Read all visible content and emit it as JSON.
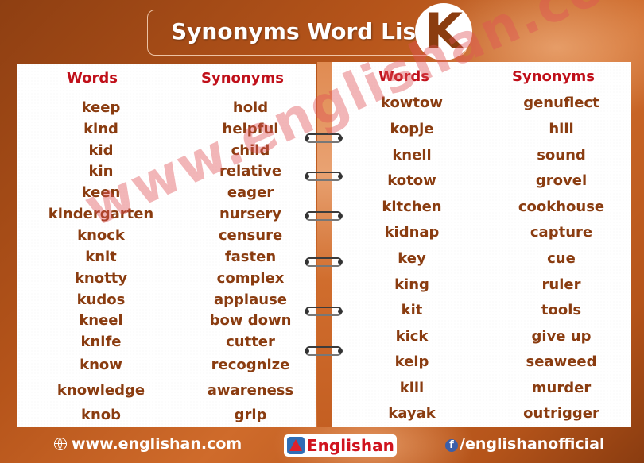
{
  "header": {
    "title": "Synonyms Word List",
    "letter": "K"
  },
  "columns": {
    "words": "Words",
    "synonyms": "Synonyms"
  },
  "left_list": [
    {
      "word": "keep",
      "synonym": "hold"
    },
    {
      "word": "kind",
      "synonym": "helpful"
    },
    {
      "word": "kid",
      "synonym": "child"
    },
    {
      "word": "kin",
      "synonym": "relative"
    },
    {
      "word": "keen",
      "synonym": "eager"
    },
    {
      "word": "kindergarten",
      "synonym": "nursery"
    },
    {
      "word": "knock",
      "synonym": "censure"
    },
    {
      "word": "knit",
      "synonym": "fasten"
    },
    {
      "word": "knotty",
      "synonym": "complex"
    },
    {
      "word": "kudos",
      "synonym": "applause"
    },
    {
      "word": "kneel",
      "synonym": "bow down"
    },
    {
      "word": "knife",
      "synonym": "cutter"
    },
    {
      "word": "know",
      "synonym": "recognize"
    },
    {
      "word": "knowledge",
      "synonym": "awareness"
    },
    {
      "word": "knob",
      "synonym": "grip"
    }
  ],
  "right_list": [
    {
      "word": "kowtow",
      "synonym": "genuflect"
    },
    {
      "word": "kopje",
      "synonym": "hill"
    },
    {
      "word": "knell",
      "synonym": "sound"
    },
    {
      "word": "kotow",
      "synonym": "grovel"
    },
    {
      "word": "kitchen",
      "synonym": "cookhouse"
    },
    {
      "word": "kidnap",
      "synonym": "capture"
    },
    {
      "word": "key",
      "synonym": "cue"
    },
    {
      "word": "king",
      "synonym": "ruler"
    },
    {
      "word": "kit",
      "synonym": "tools"
    },
    {
      "word": "kick",
      "synonym": "give up"
    },
    {
      "word": "kelp",
      "synonym": "seaweed"
    },
    {
      "word": "kill",
      "synonym": "murder"
    },
    {
      "word": "kayak",
      "synonym": "outrigger"
    }
  ],
  "watermark": "www.englishan.com",
  "footer": {
    "website": "www.englishan.com",
    "logo": "Englishan",
    "social": "/englishanofficial"
  },
  "colors": {
    "heading": "#c0101a",
    "word_text": "#8a3c10",
    "background": "#b5541a"
  }
}
